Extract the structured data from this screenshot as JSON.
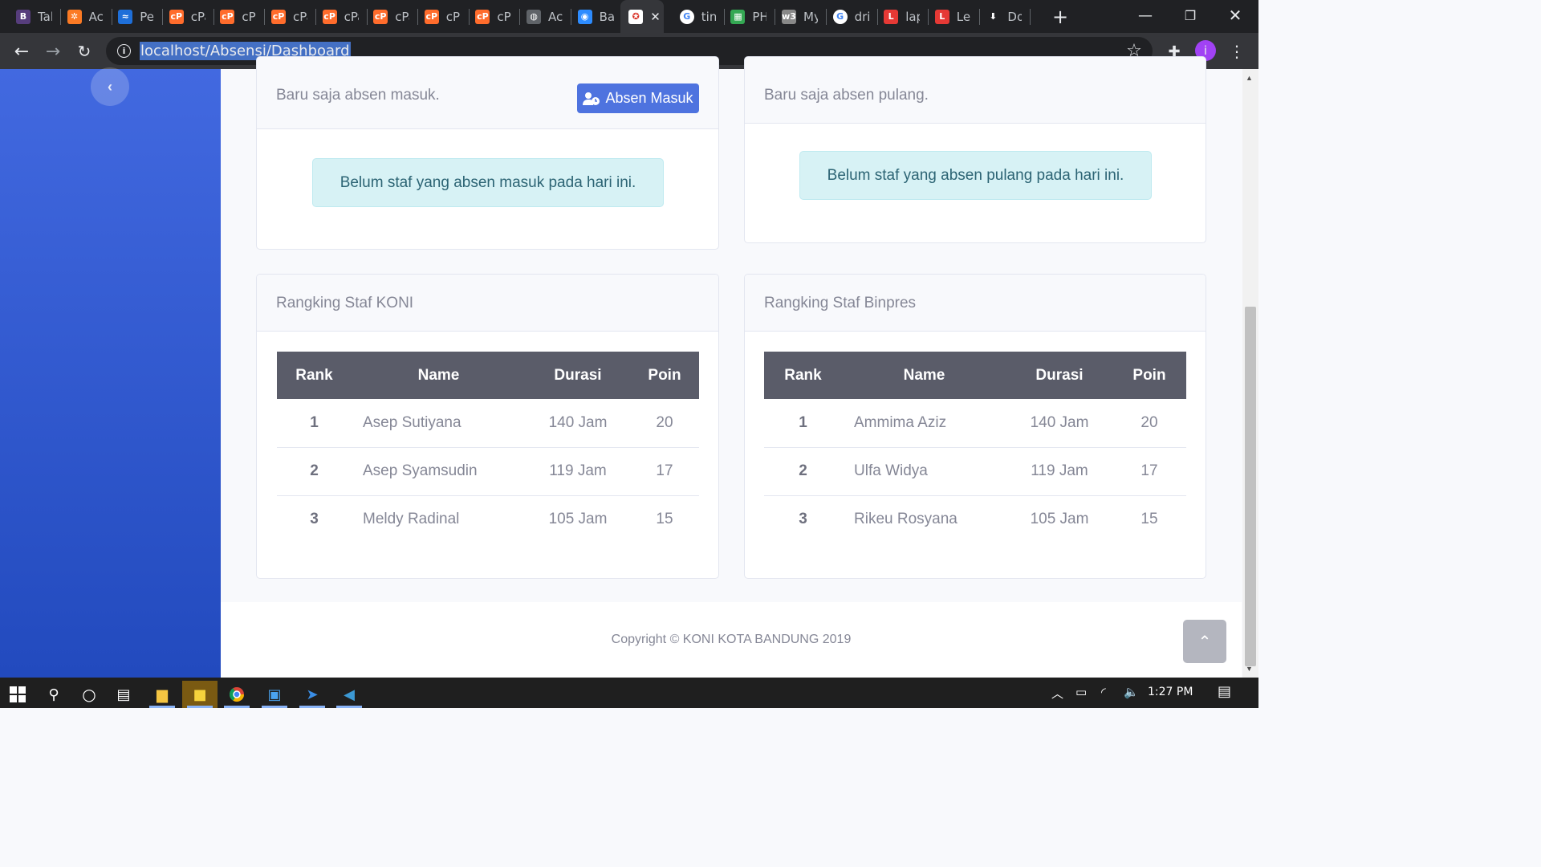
{
  "browser": {
    "tabs": [
      {
        "label": "Tal",
        "icon": "bootstrap-icon",
        "color": "#563d7c",
        "glyph": "B"
      },
      {
        "label": "Ac",
        "icon": "xampp-icon",
        "color": "#fb7a24",
        "glyph": "✲"
      },
      {
        "label": "Pe",
        "icon": "site-icon",
        "color": "#1e6fd9",
        "glyph": "≈"
      },
      {
        "label": "cPa",
        "icon": "cpanel-icon",
        "color": "#ff6c2c",
        "glyph": "cP"
      },
      {
        "label": "cPa",
        "icon": "cpanel-icon",
        "color": "#ff6c2c",
        "glyph": "cP"
      },
      {
        "label": "cPa",
        "icon": "cpanel-icon",
        "color": "#ff6c2c",
        "glyph": "cP"
      },
      {
        "label": "cPa",
        "icon": "cpanel-icon",
        "color": "#ff6c2c",
        "glyph": "cP"
      },
      {
        "label": "cPa",
        "icon": "cpanel-icon",
        "color": "#ff6c2c",
        "glyph": "cP"
      },
      {
        "label": "cP",
        "icon": "cpanel-icon",
        "color": "#ff6c2c",
        "glyph": "cP"
      },
      {
        "label": "cP",
        "icon": "cpanel-icon",
        "color": "#ff6c2c",
        "glyph": "cP"
      },
      {
        "label": "Ac",
        "icon": "globe-icon",
        "color": "#5f6368",
        "glyph": "◍"
      },
      {
        "label": "Ba",
        "icon": "zoom-icon",
        "color": "#2d8cff",
        "glyph": "◉"
      },
      {
        "label": "",
        "icon": "koni-icon",
        "color": "#ffffff",
        "glyph": "✪",
        "active": true
      },
      {
        "label": "tin",
        "icon": "google-icon",
        "color": "#ffffff",
        "glyph": "G"
      },
      {
        "label": "PH",
        "icon": "sheet-icon",
        "color": "#34a853",
        "glyph": "▦"
      },
      {
        "label": "My",
        "icon": "w3-icon",
        "color": "#888888",
        "glyph": "w3"
      },
      {
        "label": "dri",
        "icon": "google-icon",
        "color": "#ffffff",
        "glyph": "G"
      },
      {
        "label": "lap",
        "icon": "letter-l-icon",
        "color": "#e53935",
        "glyph": "L"
      },
      {
        "label": "Le",
        "icon": "letter-l-icon",
        "color": "#e53935",
        "glyph": "L"
      },
      {
        "label": "Do",
        "icon": "download-icon",
        "color": "#202124",
        "glyph": "⬇"
      }
    ],
    "url": "localhost/Absensi/Dashboard",
    "profile_initial": "i"
  },
  "dashboard": {
    "checkin_card": {
      "title": "Baru saja absen masuk.",
      "button_label": "Absen Masuk",
      "alert": "Belum staf yang absen masuk pada hari ini."
    },
    "checkout_card": {
      "title": "Baru saja absen pulang.",
      "alert": "Belum staf yang absen pulang pada hari ini."
    },
    "rank_koni": {
      "title": "Rangking Staf KONI",
      "headers": [
        "Rank",
        "Name",
        "Durasi",
        "Poin"
      ],
      "rows": [
        [
          "1",
          "Asep Sutiyana",
          "140 Jam",
          "20"
        ],
        [
          "2",
          "Asep Syamsudin",
          "119 Jam",
          "17"
        ],
        [
          "3",
          "Meldy Radinal",
          "105 Jam",
          "15"
        ]
      ]
    },
    "rank_binpres": {
      "title": "Rangking Staf Binpres",
      "headers": [
        "Rank",
        "Name",
        "Durasi",
        "Poin"
      ],
      "rows": [
        [
          "1",
          "Ammima Aziz",
          "140 Jam",
          "20"
        ],
        [
          "2",
          "Ulfa Widya",
          "119 Jam",
          "17"
        ],
        [
          "3",
          "Rikeu Rosyana",
          "105 Jam",
          "15"
        ]
      ]
    },
    "footer": "Copyright © KONI KOTA BANDUNG 2019"
  },
  "taskbar": {
    "clock": "1:27 PM"
  }
}
